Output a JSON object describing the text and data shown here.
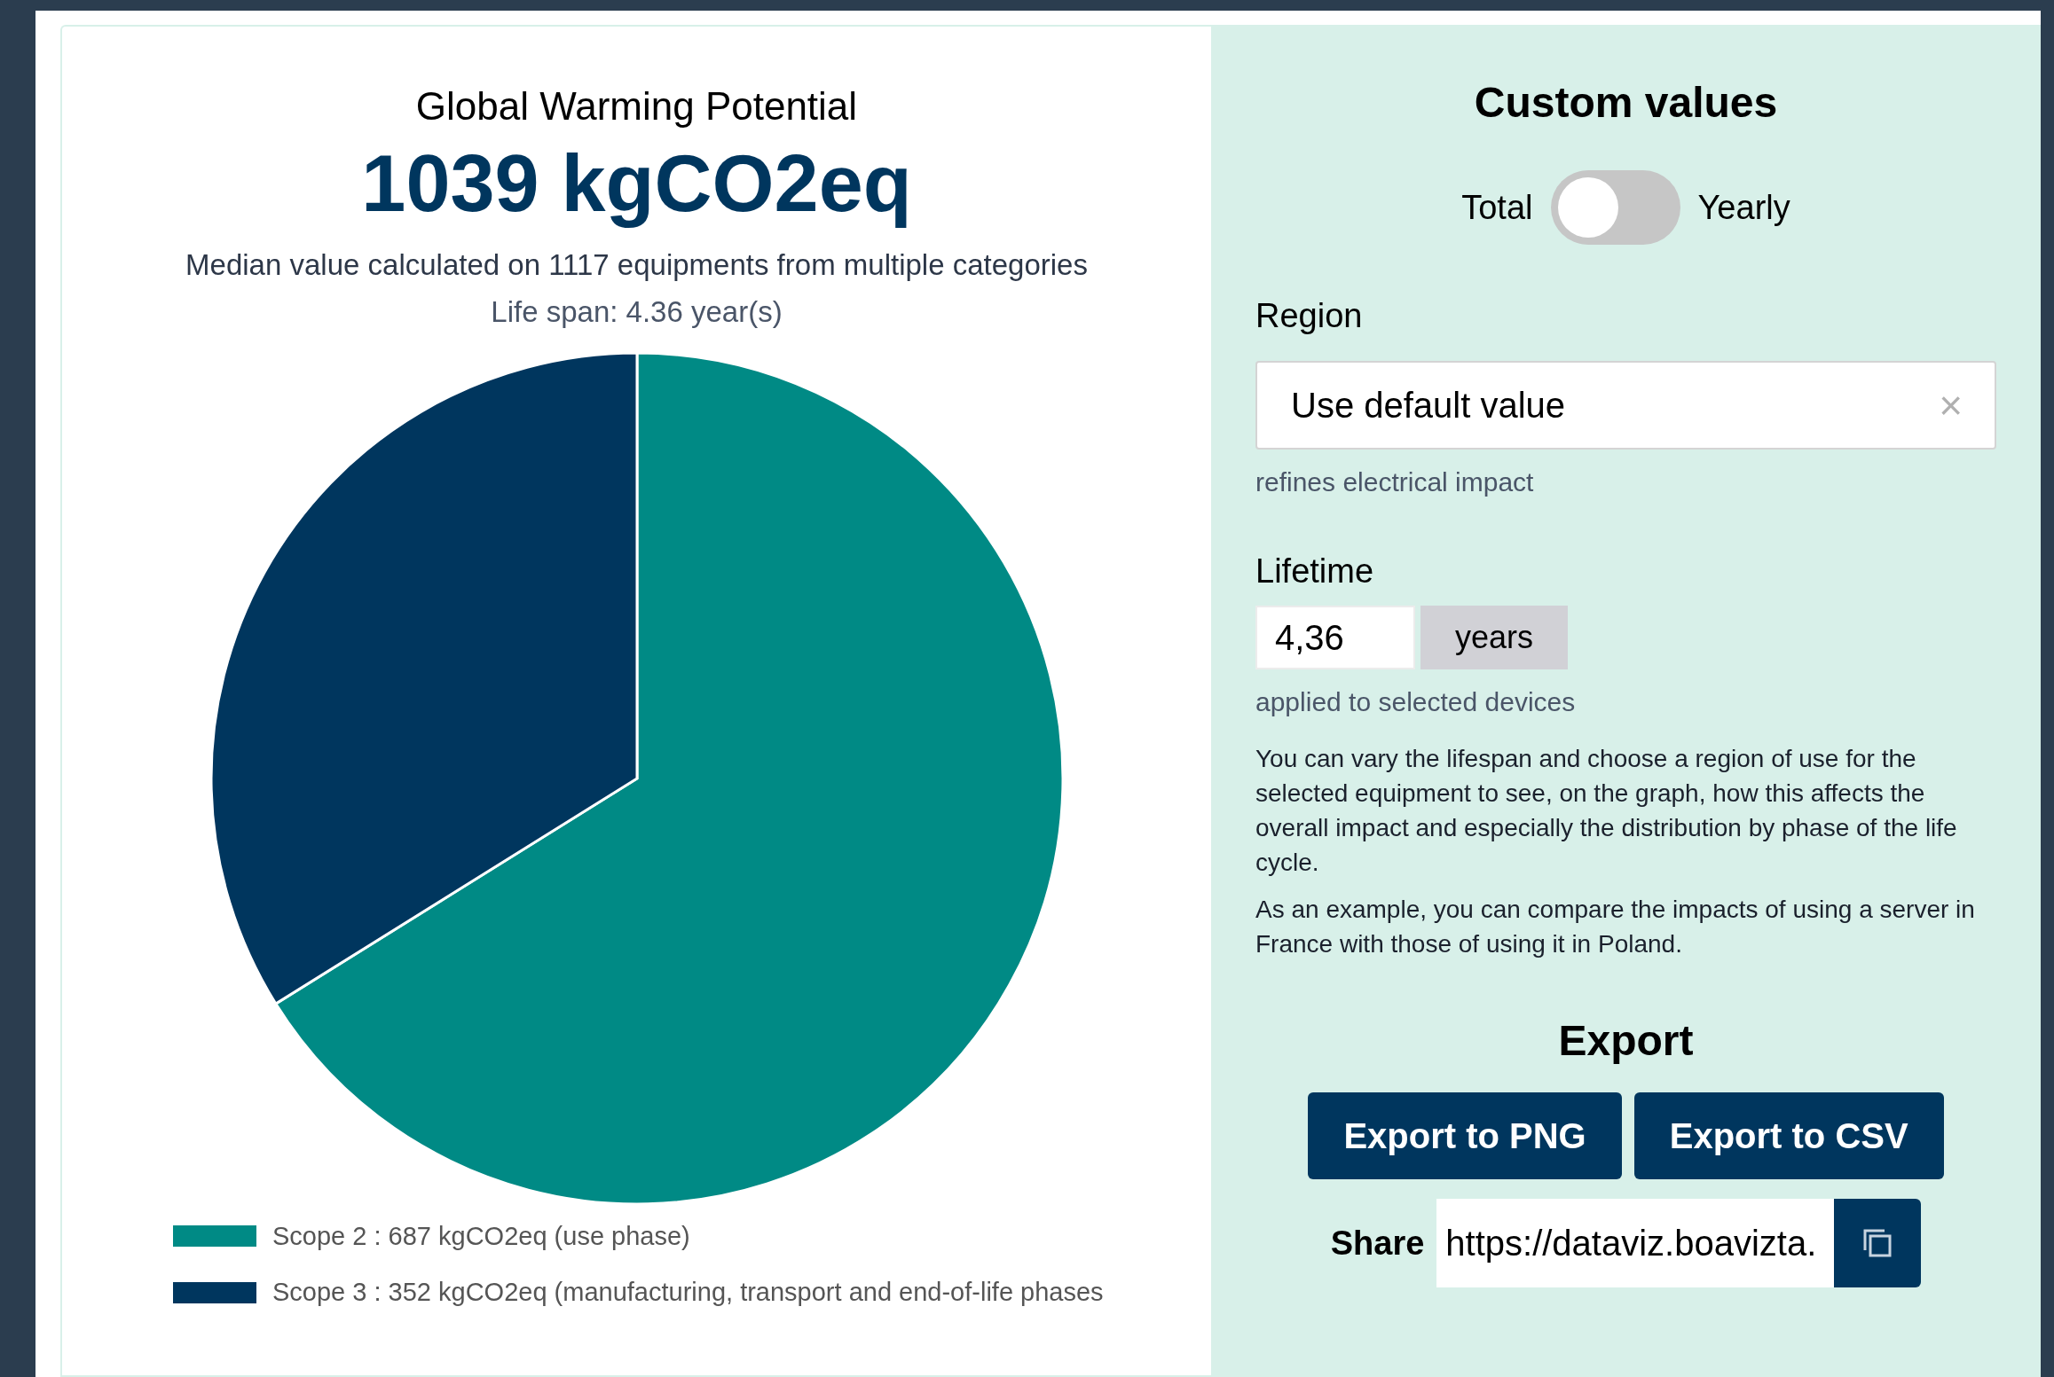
{
  "impact": {
    "title": "Global Warming Potential",
    "value": "1039 kgCO2eq",
    "description": "Median value calculated on 1117 equipments from multiple categories",
    "lifespan": "Life span: 4.36 year(s)",
    "chart_data": {
      "type": "pie",
      "categories": [
        "Scope 2 : 687 kgCO2eq (use phase)",
        "Scope 3 : 352 kgCO2eq (manufacturing, transport and end-of-life phases"
      ],
      "values": [
        687,
        352
      ],
      "colors": [
        "#008a85",
        "#00365e"
      ]
    }
  },
  "custom": {
    "title": "Custom values",
    "toggle": {
      "left_label": "Total",
      "right_label": "Yearly",
      "on": false
    },
    "region": {
      "label": "Region",
      "value": "Use default value",
      "clear": "×",
      "hint": "refines electrical impact"
    },
    "lifetime": {
      "label": "Lifetime",
      "value": "4,36",
      "unit": "years",
      "hint": "applied to selected devices"
    },
    "paragraphs": [
      "You can vary the lifespan and choose a region of use for the selected equipment to see, on the graph, how this affects the overall impact and especially the distribution by phase of the life cycle.",
      "As an example, you can compare the impacts of using a server in France with those of using it in Poland."
    ]
  },
  "export": {
    "title": "Export",
    "buttons": [
      "Export to PNG",
      "Export to CSV"
    ],
    "share_label": "Share",
    "share_value": "https://dataviz.boavizta."
  }
}
